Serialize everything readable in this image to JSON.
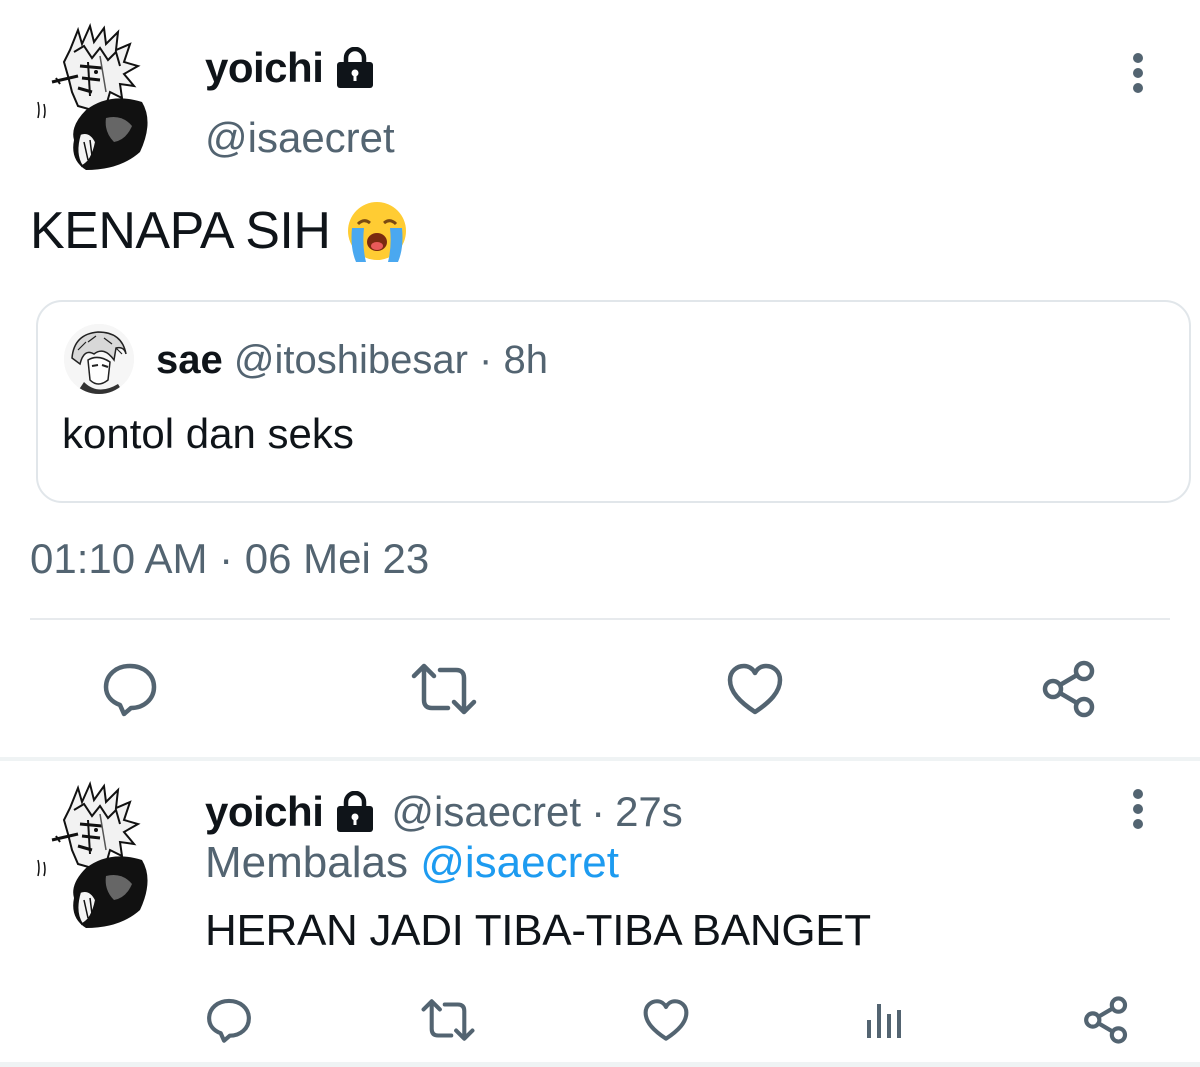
{
  "main_tweet": {
    "display_name": "yoichi",
    "handle": "@isaecret",
    "text": "KENAPA SIH",
    "emoji": "loudly-crying-face",
    "quoted": {
      "display_name": "sae",
      "handle": "@itoshibesar",
      "separator": "·",
      "age": "8h",
      "text": "kontol dan seks"
    },
    "timestamp": "01:10 AM · 06 Mei 23"
  },
  "reply_tweet": {
    "display_name": "yoichi",
    "handle": "@isaecret",
    "separator": "·",
    "age": "27s",
    "replying_prefix": "Membalas",
    "replying_to": "@isaecret",
    "text": "HERAN JADI TIBA-TIBA BANGET"
  },
  "icons": {
    "lock": "lock-icon",
    "more": "more-vertical-icon",
    "reply": "reply-icon",
    "retweet": "retweet-icon",
    "like": "heart-icon",
    "views": "views-chart-icon",
    "share": "share-icon"
  },
  "colors": {
    "text": "#0f1419",
    "secondary": "#536471",
    "link": "#1d9bf0",
    "border": "#e1e6ea"
  }
}
